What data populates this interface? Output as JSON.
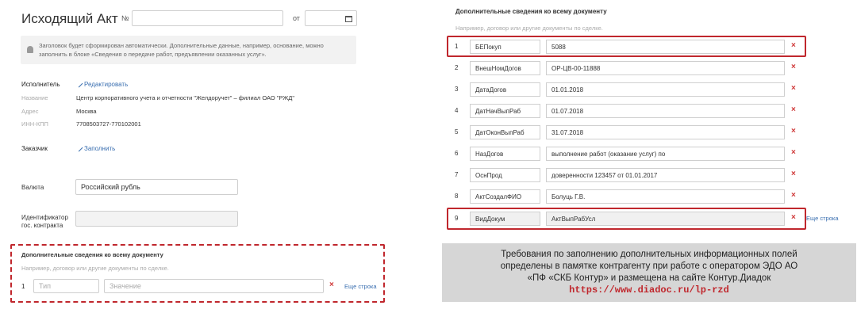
{
  "form": {
    "title": "Исходящий Акт",
    "number_label": "№",
    "number_value": "",
    "date_label": "от",
    "date_value": ""
  },
  "notice": {
    "text": "Заголовок будет сформирован автоматически. Дополнительные данные, например, основание, можно заполнить в блоке «Сведения о передаче работ, предъявлении оказанных услуг»."
  },
  "executor": {
    "label": "Исполнитель",
    "edit_link": "Редактировать",
    "name_key": "Название",
    "name_value": "Центр корпоративного учета и отчетности \"Желдоручет\" – филиал ОАО \"РЖД\"",
    "address_key": "Адрес",
    "address_value": "Москва",
    "inn_key": "ИНН-КПП",
    "inn_value": "7708503727-770102001"
  },
  "customer": {
    "label": "Заказчик",
    "fill_link": "Заполнить"
  },
  "currency": {
    "label": "Валюта",
    "value": "Российский рубль"
  },
  "contract_id": {
    "label_line1": "Идентификатор",
    "label_line2": "гос. контракта",
    "value": ""
  },
  "left_extra": {
    "heading": "Дополнительные сведения ко всему документу",
    "hint": "Например, договор или другие документы по сделке.",
    "row_num": "1",
    "type_placeholder": "Тип",
    "value_placeholder": "Значение",
    "delete_glyph": "×",
    "more_link": "Еще строка"
  },
  "right_extra": {
    "heading": "Дополнительные сведения ко всему документу",
    "hint": "Например, договор или другие документы по сделке.",
    "delete_glyph": "×",
    "more_link": "Еще строка",
    "rows": [
      {
        "num": "1",
        "type": "БЕПокуп",
        "value": "5088"
      },
      {
        "num": "2",
        "type": "ВнешНомДогов",
        "value": "ОР-ЦВ-00-11888"
      },
      {
        "num": "3",
        "type": "ДатаДогов",
        "value": "01.01.2018"
      },
      {
        "num": "4",
        "type": "ДатНачВыпРаб",
        "value": "01.07.2018"
      },
      {
        "num": "5",
        "type": "ДатОконВыпРаб",
        "value": "31.07.2018"
      },
      {
        "num": "6",
        "type": "НазДогов",
        "value": "выполнение работ (оказание услуг) по"
      },
      {
        "num": "7",
        "type": "ОснПрод",
        "value": "доверенности 123457 от 01.01.2017"
      },
      {
        "num": "8",
        "type": "АктСоздалФИО",
        "value": "Болуць Г.В."
      },
      {
        "num": "9",
        "type": "ВидДокум",
        "value": "АктВыпРабУсл"
      }
    ]
  },
  "info": {
    "line1": "Требования по заполнению дополнительных информационных полей",
    "line2": "определены в памятке контрагенту при работе с оператором ЭДО АО",
    "line3": "«ПФ «СКБ Контур» и размещена на сайте Контур.Диадок",
    "url": "https://www.diadoc.ru/lp-rzd"
  },
  "colors": {
    "highlight": "#c0272d",
    "link": "#3a6fb0",
    "delete": "#d03a3a"
  }
}
